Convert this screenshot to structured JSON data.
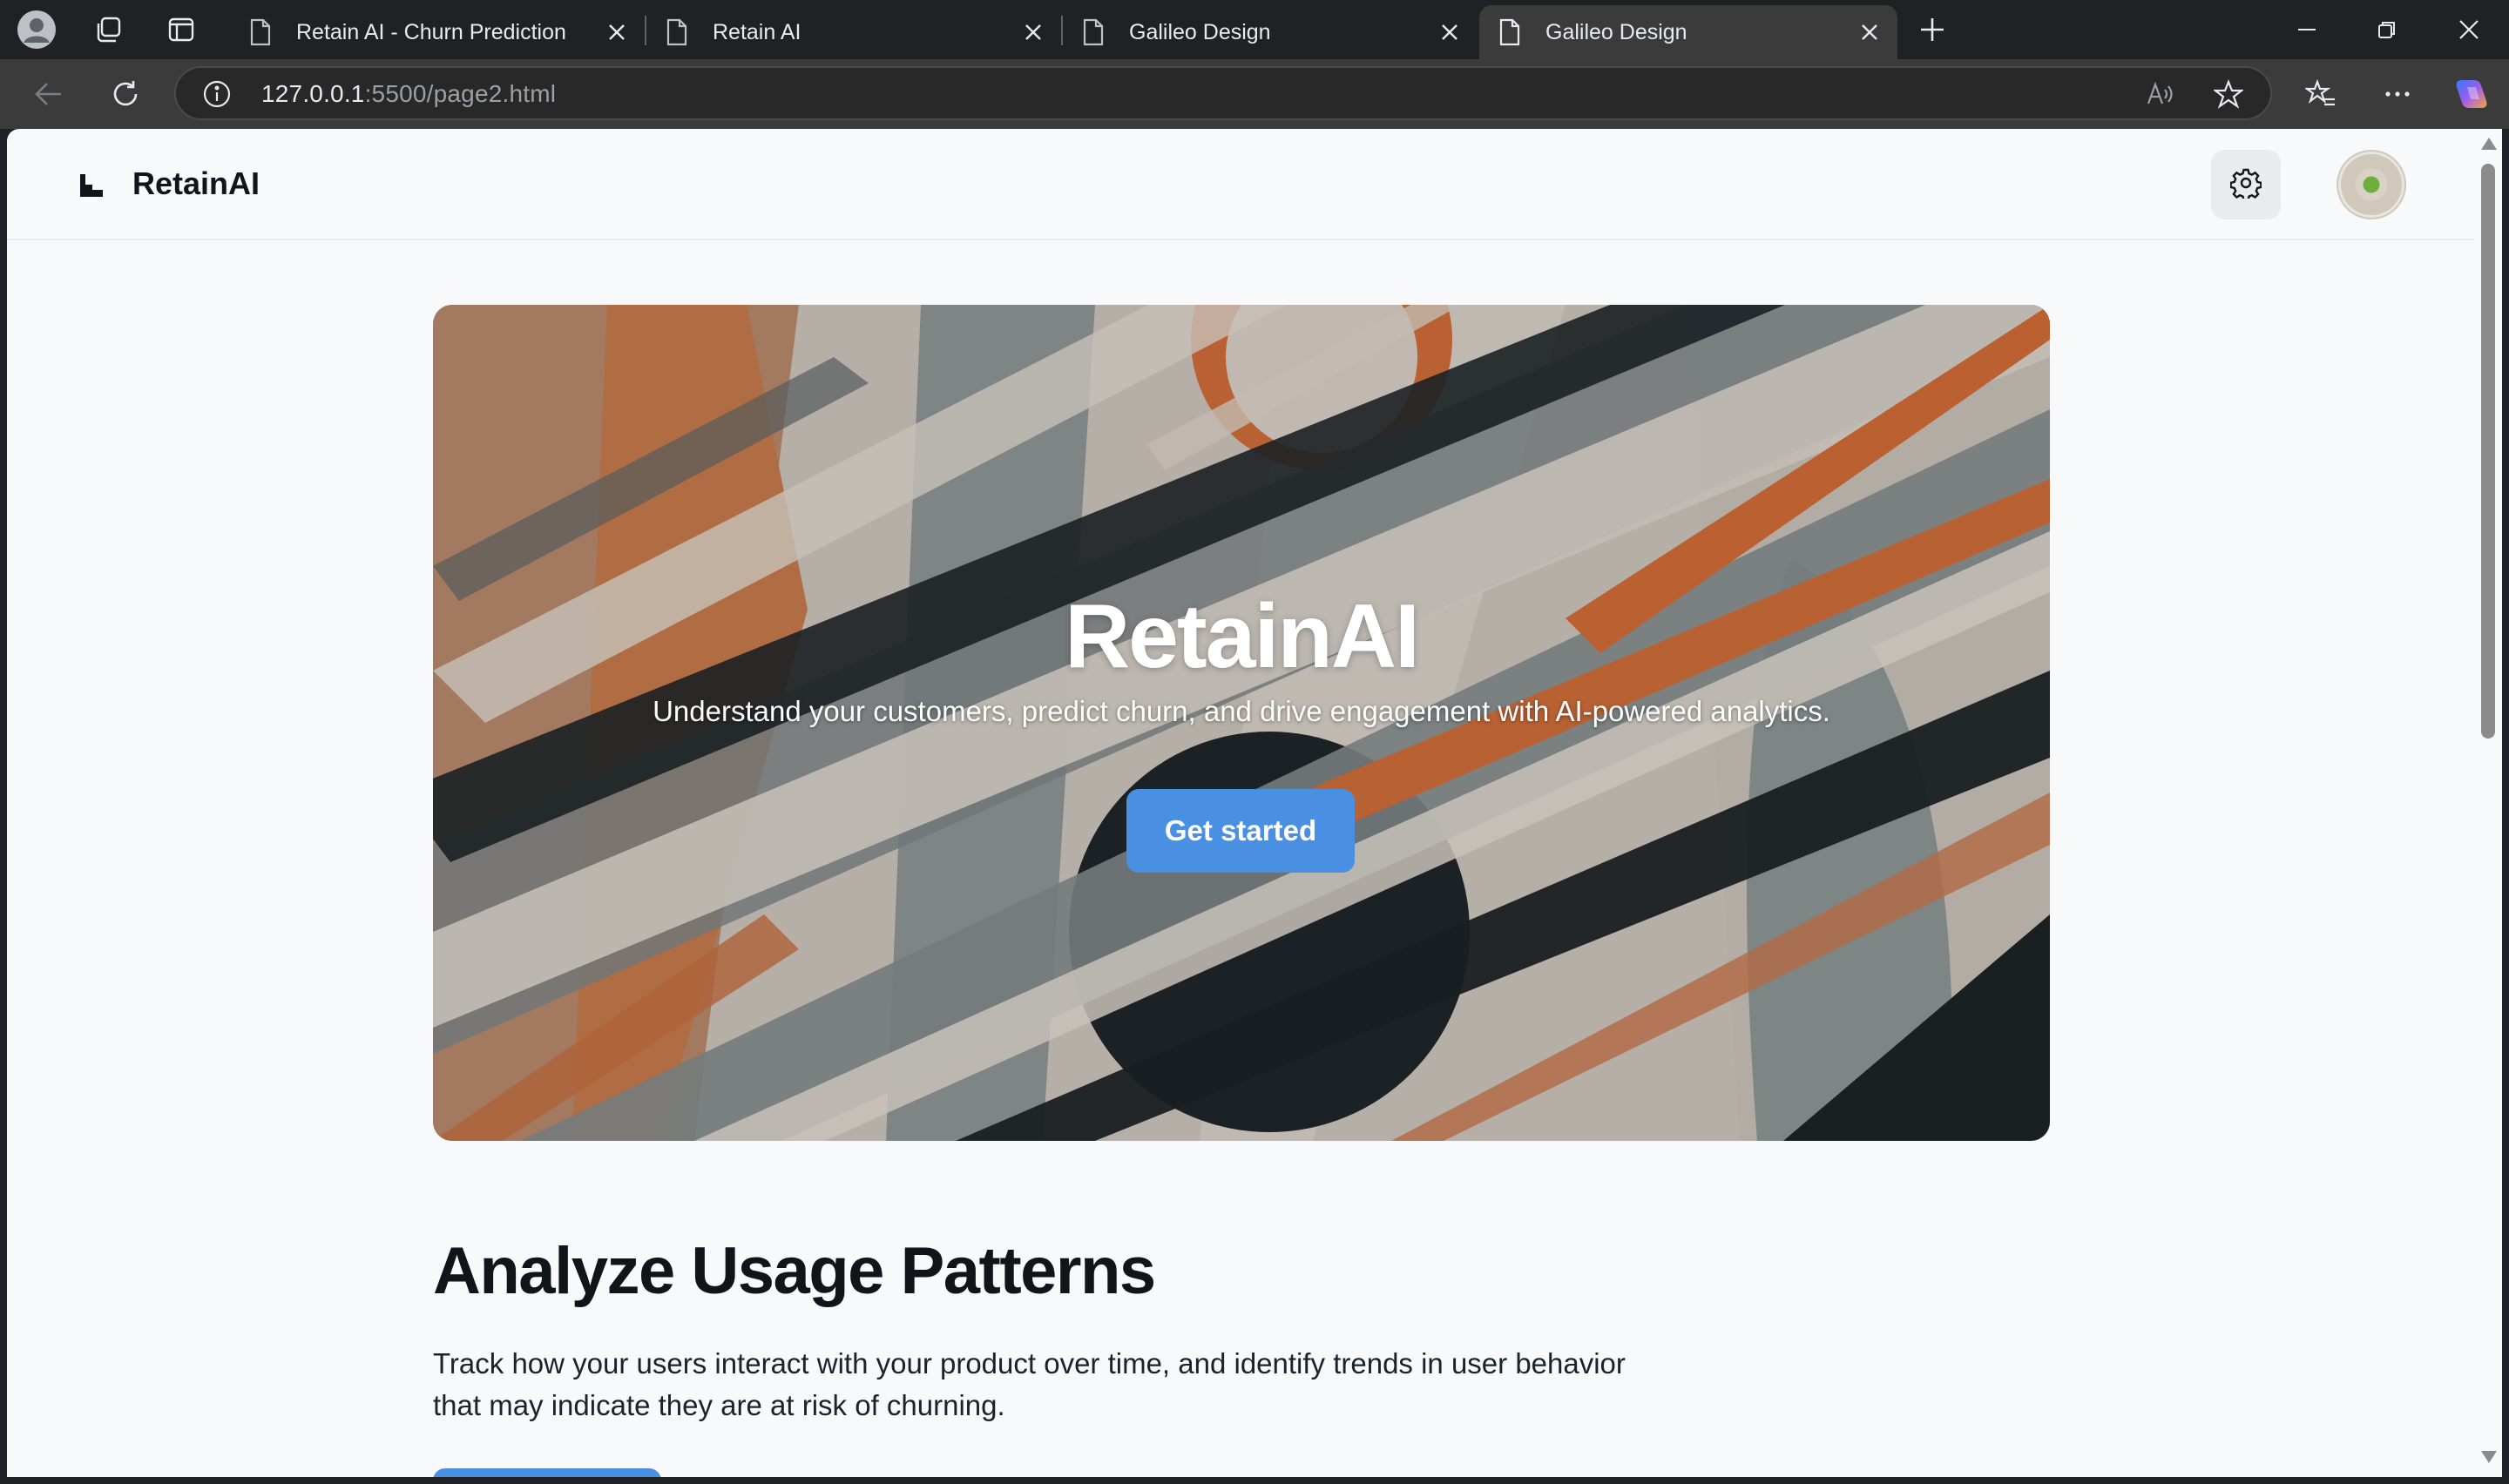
{
  "browser": {
    "tabs": [
      {
        "title": "Retain AI - Churn Prediction",
        "active": false
      },
      {
        "title": "Retain AI",
        "active": false
      },
      {
        "title": "Galileo Design",
        "active": false
      },
      {
        "title": "Galileo Design",
        "active": true
      }
    ],
    "url_host": "127.0.0.1",
    "url_path": ":5500/page2.html"
  },
  "app": {
    "brand": "RetainAI"
  },
  "hero": {
    "title": "RetainAI",
    "subtitle": "Understand your customers, predict churn, and drive engagement with AI-powered analytics.",
    "cta": "Get started"
  },
  "section": {
    "title": "Analyze Usage Patterns",
    "body": "Track how your users interact with your product over time, and identify trends in user behavior that may indicate they are at risk of churning."
  },
  "colors": {
    "accent": "#4a90e2",
    "page_bg": "#f7f9fb",
    "text": "#111418"
  },
  "icons": {
    "settings": "gear-icon",
    "avatar": "avatar",
    "logo": "logo-icon"
  }
}
